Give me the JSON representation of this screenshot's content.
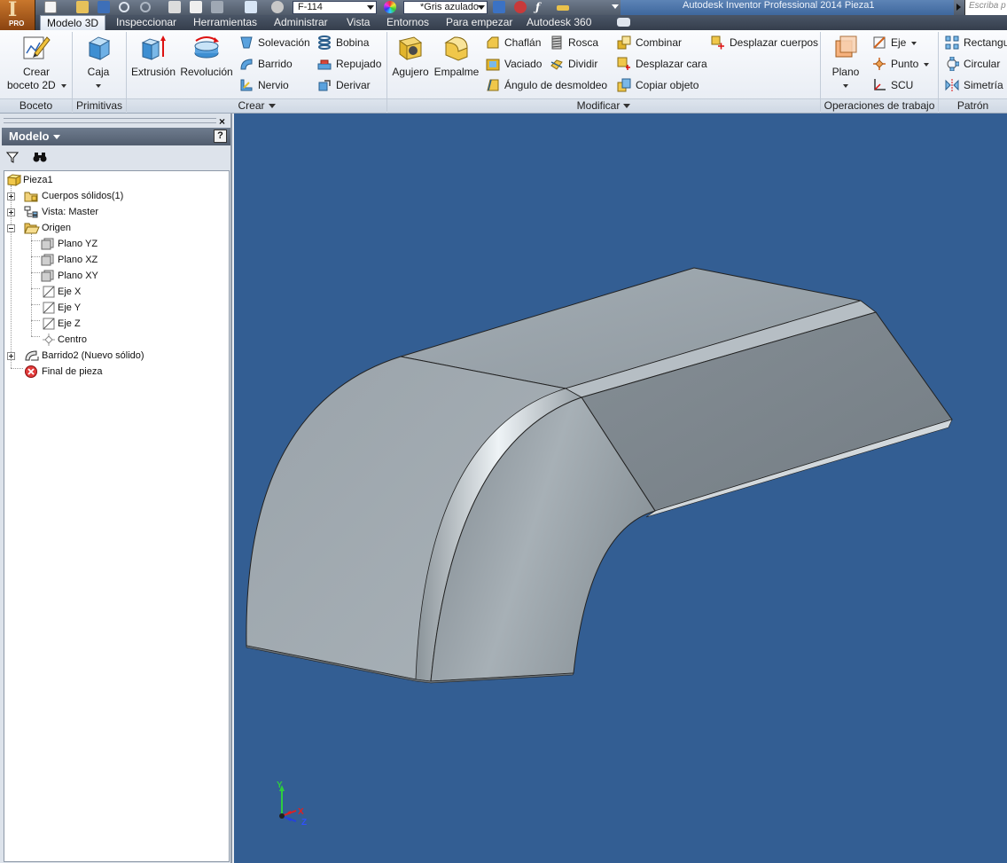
{
  "app": {
    "title": "Autodesk Inventor Professional 2014    Pieza1",
    "badge": "PRO",
    "search_placeholder": "Escriba p"
  },
  "quick_access": {
    "material": "F-114",
    "appearance": "*Gris azulado"
  },
  "tabs": [
    "Modelo 3D",
    "Inspeccionar",
    "Herramientas",
    "Administrar",
    "Vista",
    "Entornos",
    "Para empezar",
    "Autodesk 360"
  ],
  "active_tab": "Modelo 3D",
  "ribbon": {
    "boceto": {
      "title": "Boceto",
      "create_sketch_line1": "Crear",
      "create_sketch_line2": "boceto 2D"
    },
    "primitivas": {
      "title": "Primitivas",
      "box": "Caja"
    },
    "crear": {
      "title": "Crear",
      "extrude": "Extrusión",
      "revolve": "Revolución",
      "loft": "Solevación",
      "sweep": "Barrido",
      "rib": "Nervio",
      "coil": "Bobina",
      "emboss": "Repujado",
      "derive": "Derivar"
    },
    "modificar": {
      "title": "Modificar",
      "hole": "Agujero",
      "fillet": "Empalme",
      "chamfer": "Chaflán",
      "shell": "Vaciado",
      "draft": "Ángulo de desmoldeo",
      "thread": "Rosca",
      "split": "Dividir",
      "combine": "Combinar",
      "direct_edit": "Desplazar cara",
      "copy_object": "Copiar objeto",
      "move_bodies": "Desplazar cuerpos"
    },
    "operaciones": {
      "title": "Operaciones de trabajo",
      "plane": "Plano",
      "axis": "Eje",
      "point": "Punto",
      "ucs": "SCU"
    },
    "patron": {
      "title": "Patrón",
      "rectangular": "Rectangular",
      "circular": "Circular",
      "mirror": "Simetría"
    }
  },
  "browser": {
    "title": "Modelo",
    "help": "?",
    "close": "×",
    "tree": [
      {
        "label": "Pieza1"
      },
      {
        "label": "Cuerpos sólidos(1)"
      },
      {
        "label": "Vista: Master"
      },
      {
        "label": "Origen"
      },
      {
        "label": "Plano YZ"
      },
      {
        "label": "Plano XZ"
      },
      {
        "label": "Plano XY"
      },
      {
        "label": "Eje X"
      },
      {
        "label": "Eje Y"
      },
      {
        "label": "Eje Z"
      },
      {
        "label": "Centro"
      },
      {
        "label": "Barrido2 (Nuevo sólido)"
      },
      {
        "label": "Final de pieza"
      }
    ]
  },
  "viewport": {
    "background": "#335e93",
    "triad": {
      "x_label": "X",
      "y_label": "Y",
      "z_label": "Z"
    }
  }
}
